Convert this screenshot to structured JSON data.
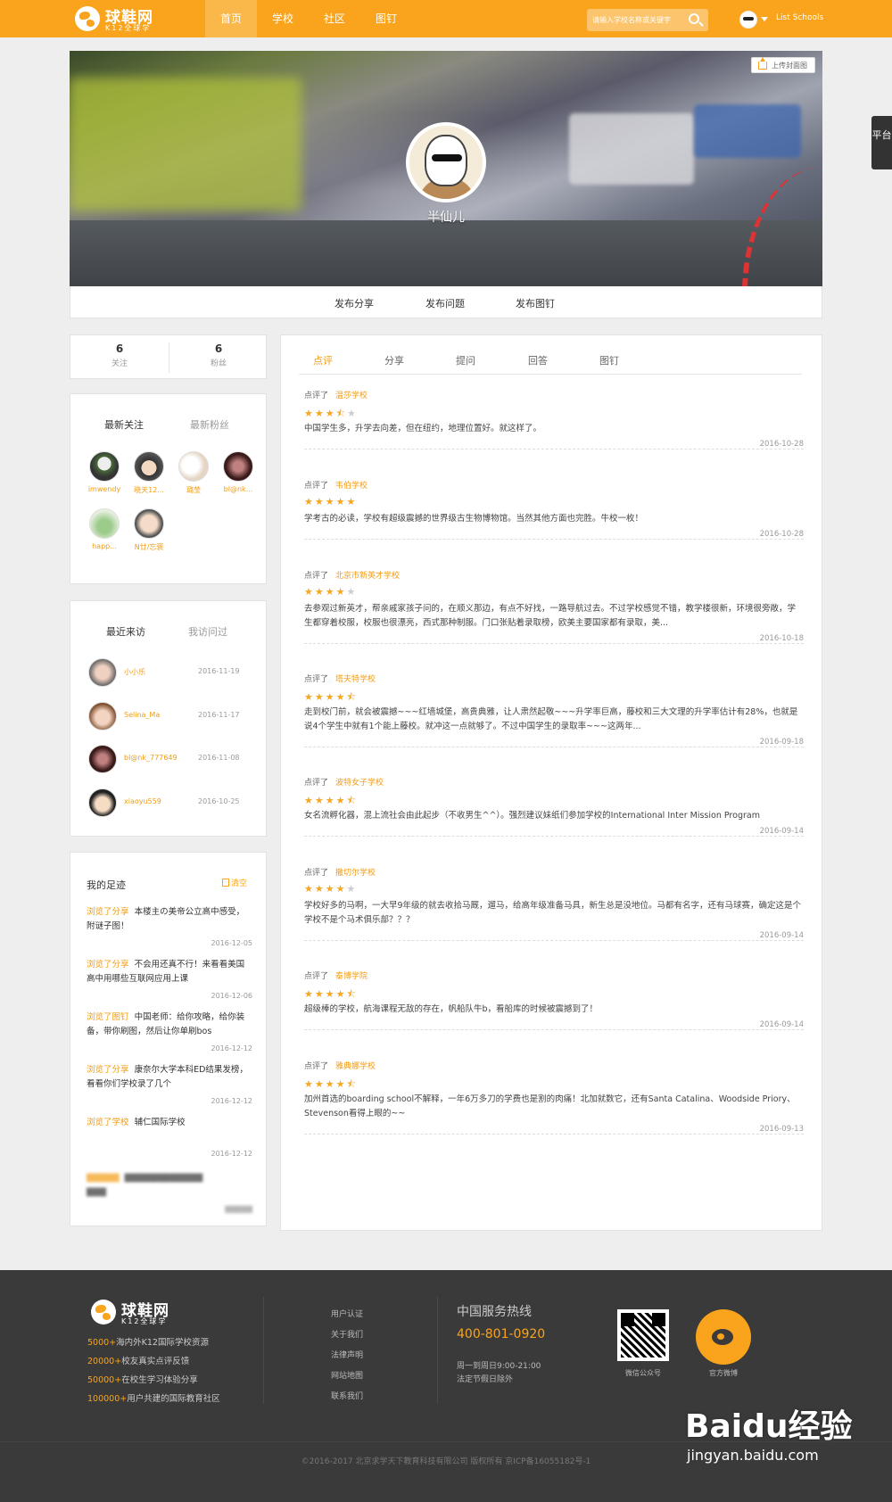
{
  "header": {
    "logo_name": "球鞋网",
    "logo_tagline": "K12全球学",
    "nav": [
      "首页",
      "学校",
      "社区",
      "图钉"
    ],
    "search_placeholder": "请输入学校名称或关键字",
    "username": "List Schools"
  },
  "side_tab": "平台",
  "profile": {
    "name": "半仙儿",
    "upload_cover": "上传封面图"
  },
  "actions": [
    "发布分享",
    "发布问题",
    "发布图钉"
  ],
  "stats": [
    {
      "value": "6",
      "label": "关注"
    },
    {
      "value": "6",
      "label": "粉丝"
    }
  ],
  "follow_card": {
    "tabs": [
      "最新关注",
      "最新粉丝"
    ],
    "users": [
      "imwendy",
      "晓天12...",
      "璐莹",
      "bl@nk...",
      "happ...",
      "N廿/忘褒"
    ]
  },
  "visit_card": {
    "tabs": [
      "最近来访",
      "我访问过"
    ],
    "visitors": [
      {
        "name": "小小乐",
        "date": "2016-11-19"
      },
      {
        "name": "Selina_Ma",
        "date": "2016-11-17"
      },
      {
        "name": "bl@nk_777649",
        "date": "2016-11-08"
      },
      {
        "name": "xiaoyu559",
        "date": "2016-10-25"
      }
    ]
  },
  "track_card": {
    "title": "我的足迹",
    "clear": "清空",
    "items": [
      {
        "action": "浏览了分享",
        "text": "本楼主の美帝公立高中感受，附谜子图！",
        "date": "2016-12-05"
      },
      {
        "action": "浏览了分享",
        "text": "不会用还真不行！来看看美国高中用哪些互联网应用上课",
        "date": "2016-12-06"
      },
      {
        "action": "浏览了图钉",
        "text": "中国老师：给你攻略，给你装备，带你刷图，然后让你单刷bos",
        "date": "2016-12-12"
      },
      {
        "action": "浏览了分享",
        "text": "康奈尔大学本科ED结果发榜，看看你们学校录了几个",
        "date": "2016-12-12"
      },
      {
        "action": "浏览了学校",
        "text": "辅仁国际学校",
        "date": "2016-12-12"
      }
    ]
  },
  "main_tabs": [
    "点评",
    "分享",
    "提问",
    "回答",
    "图钉"
  ],
  "reviews": [
    {
      "prefix": "点评了",
      "school": "温莎学校",
      "stars": 3.5,
      "text": "中国学生多，升学去向差，但在纽约，地理位置好。就这样了。",
      "date": "2016-10-28"
    },
    {
      "prefix": "点评了",
      "school": "韦伯学校",
      "stars": 5,
      "text": "学考古的必读，学校有超级震撼的世界级古生物博物馆。当然其他方面也完胜。牛校一枚！",
      "date": "2016-10-28"
    },
    {
      "prefix": "点评了",
      "school": "北京市新英才学校",
      "stars": 4,
      "text": "去参观过新英才，帮亲戚家孩子问的，在顺义那边，有点不好找，一路导航过去。不过学校感觉不错，教学楼很新，环境很旁敞，学生都穿着校服，校服也很漂亮，西式那种制服。门口张贴着录取榜，欧美主要国家都有录取，美...",
      "date": "2016-10-18"
    },
    {
      "prefix": "点评了",
      "school": "塔夫特学校",
      "stars": 4.5,
      "text": "走到校门前，就会被震撼~~~红墙城堡，高贵典雅，让人肃然起敬~~~升学率巨高，藤校和三大文理的升学率估计有28%，也就是说4个学生中就有1个能上藤校。就冲这一点就够了。不过中国学生的录取率~~~这两年...",
      "date": "2016-09-18"
    },
    {
      "prefix": "点评了",
      "school": "波特女子学校",
      "stars": 4.5,
      "text": "女名流孵化器，混上流社会由此起步（不收男生^^）。强烈建议妹纸们参加学校的International Inter Mission Program",
      "date": "2016-09-14"
    },
    {
      "prefix": "点评了",
      "school": "撒切尔学校",
      "stars": 4,
      "text": "学校好多的马啊，一大早9年级的就去收拾马厩，遛马，给高年级准备马具，新生总是没地位。马都有名字，还有马球赛，确定这是个学校不是个马术俱乐部？？？",
      "date": "2016-09-14"
    },
    {
      "prefix": "点评了",
      "school": "泰博学院",
      "stars": 4.5,
      "text": "超级棒的学校，航海课程无敌的存在，帆船队牛b，看船库的时候被震撼到了！",
      "date": "2016-09-14"
    },
    {
      "prefix": "点评了",
      "school": "雅典娜学校",
      "stars": 4.5,
      "text": "加州首选的boarding school不解释，一年6万多刀的学费也是割的肉痛！北加就数它，还有Santa Catalina、Woodside Priory、Stevenson看得上眼的~~",
      "date": "2016-09-13"
    }
  ],
  "footer": {
    "stats": [
      {
        "num": "5000+",
        "text": "海内外K12国际学校资源"
      },
      {
        "num": "20000+",
        "text": "校友真实点评反馈"
      },
      {
        "num": "50000+",
        "text": "在校生学习体验分享"
      },
      {
        "num": "100000+",
        "text": "用户共建的国际教育社区"
      }
    ],
    "links": [
      "用户认证",
      "关于我们",
      "法律声明",
      "网站地图",
      "联系我们"
    ],
    "hotline_title": "中国服务热线",
    "hotline_number": "400-801-0920",
    "hours": "周一到周日9:00-21:00",
    "holiday": "法定节假日除外",
    "qr_label": "微信公众号",
    "weibo_label": "官方微博",
    "copyright": "©2016-2017 北京求学天下教育科技有限公司 版权所有  京ICP备16055182号-1"
  },
  "watermark": {
    "brand": "Baidu经验",
    "url": "jingyan.baidu.com"
  }
}
